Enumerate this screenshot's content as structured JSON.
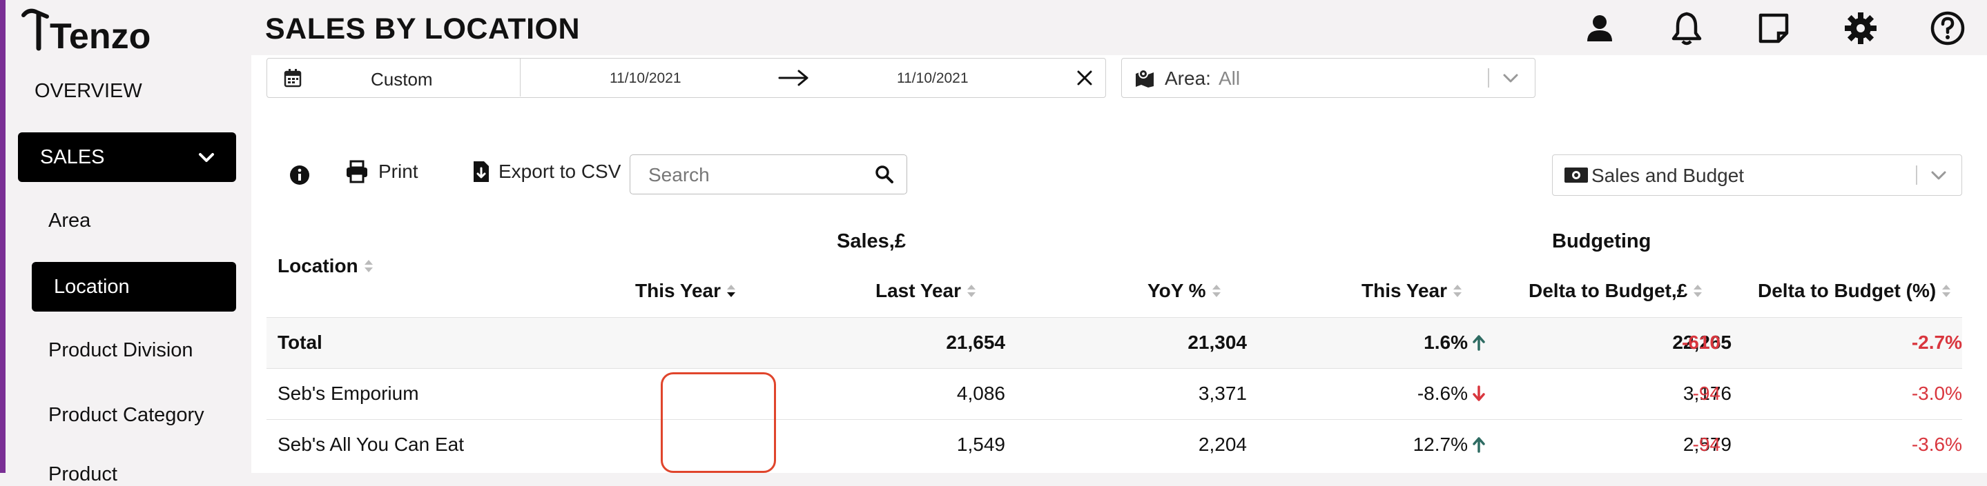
{
  "brand": "Tenzo",
  "page_title": "SALES BY LOCATION",
  "sidebar": {
    "overview": "OVERVIEW",
    "sales": "SALES",
    "items": [
      "Area",
      "Location",
      "Product Division",
      "Product Category",
      "Product"
    ]
  },
  "header_icons": [
    "user-icon",
    "bell-icon",
    "note-icon",
    "gear-icon",
    "help-icon"
  ],
  "date_filter": {
    "preset": "Custom",
    "from": "11/10/2021",
    "to": "11/10/2021"
  },
  "area_filter": {
    "label": "Area:",
    "value": "All"
  },
  "toolbar": {
    "print": "Print",
    "export": "Export to CSV",
    "search_placeholder": "Search"
  },
  "view_select": "Sales and Budget",
  "table": {
    "group_sales": "Sales,£",
    "group_budget": "Budgeting",
    "headers": {
      "location": "Location",
      "this_year": "This Year",
      "last_year": "Last Year",
      "yoy": "YoY %",
      "budget_this_year": "This Year",
      "delta": "Delta to Budget,£",
      "delta_pct": "Delta to Budget (%)"
    },
    "rows": [
      {
        "location": "Total",
        "this_year": "21,654",
        "last_year": "21,304",
        "yoy": "1.6%",
        "yoy_dir": "up",
        "budget": "22,265",
        "delta": "-610",
        "delta_pct": "-2.7%"
      },
      {
        "location": "Seb's Emporium",
        "this_year": "4,086",
        "last_year": "3,371",
        "yoy": "-8.6%",
        "yoy_dir": "down",
        "budget": "3,176",
        "delta": "-94",
        "delta_pct": "-3.0%"
      },
      {
        "location": "Seb's All You Can Eat",
        "this_year": "1,549",
        "last_year": "2,204",
        "yoy": "12.7%",
        "yoy_dir": "up",
        "budget": "2,579",
        "delta": "-94",
        "delta_pct": "-3.6%"
      }
    ]
  },
  "colors": {
    "accent_edge": "#7a2f95",
    "negative": "#d9363e",
    "up_arrow": "#2e6b62",
    "down_arrow": "#d9363e",
    "highlight": "#e0452c"
  }
}
